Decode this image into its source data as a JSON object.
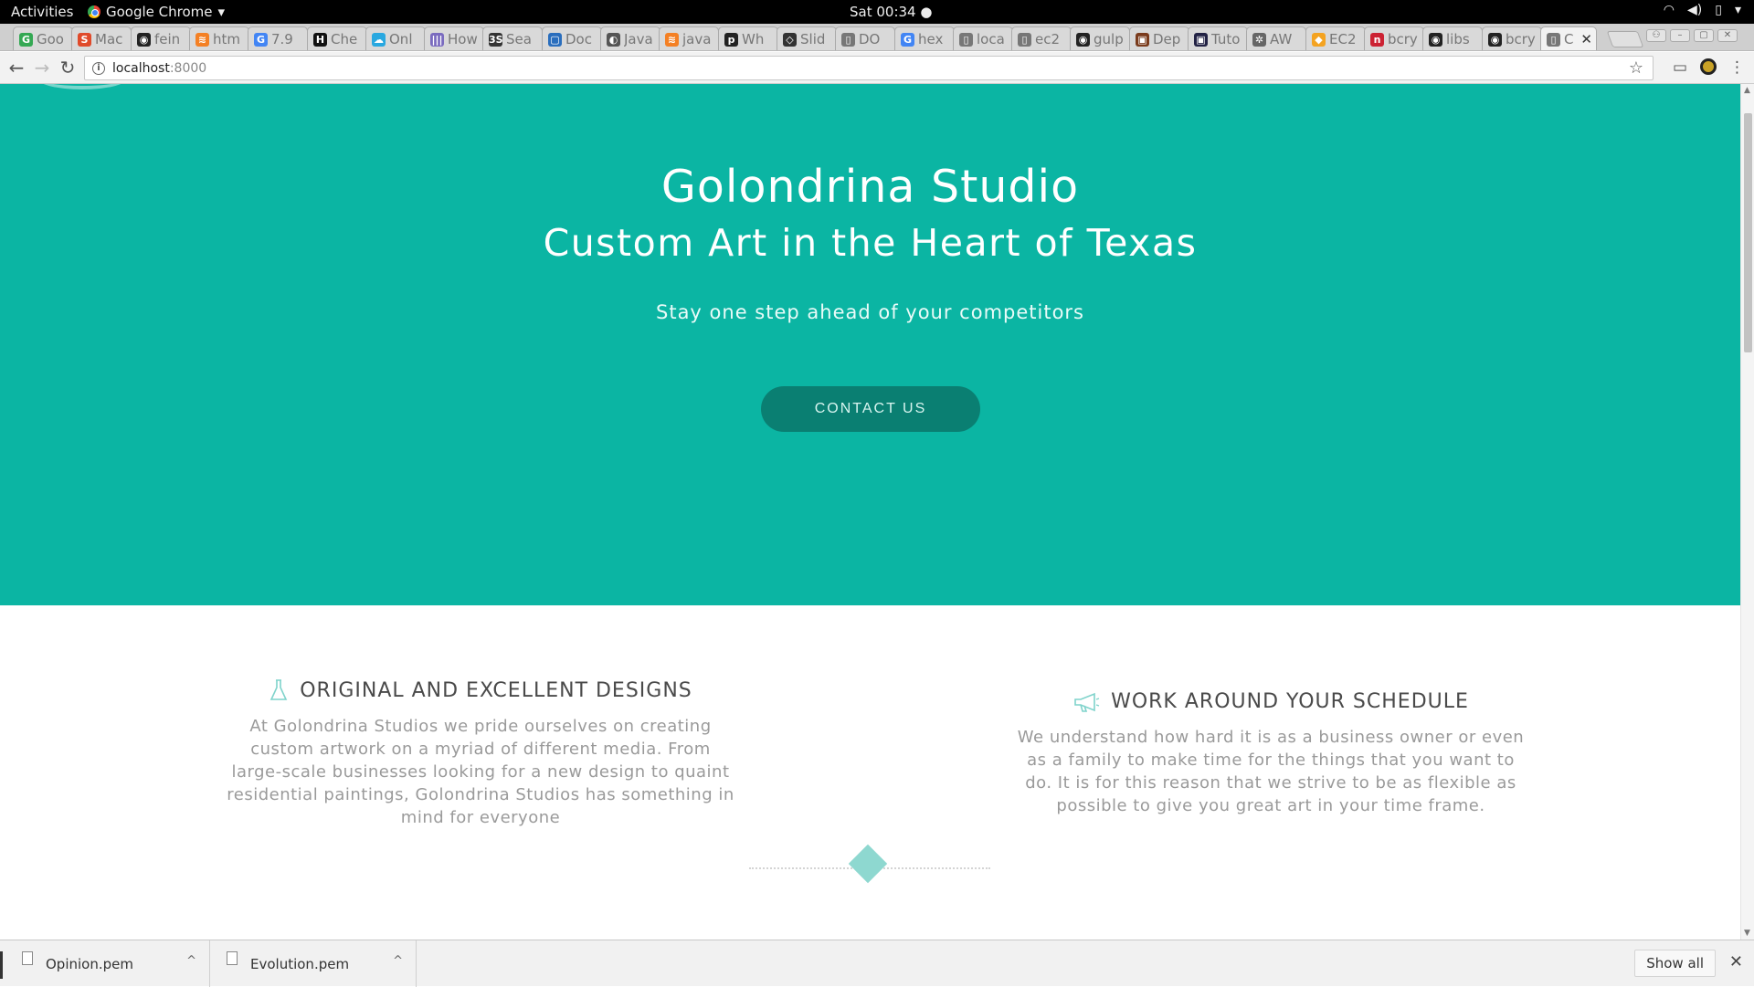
{
  "system_bar": {
    "activities": "Activities",
    "app_name": "Google Chrome",
    "clock": "Sat 00:34",
    "status_icons": [
      "wifi-icon",
      "volume-icon",
      "battery-icon",
      "power-menu-icon"
    ]
  },
  "tabs": [
    {
      "label": "Goo",
      "favicon": "G",
      "color": "#34a853"
    },
    {
      "label": "Mac",
      "favicon": "S",
      "color": "#e04a2a"
    },
    {
      "label": "fein",
      "favicon": "◉",
      "color": "#222222"
    },
    {
      "label": "htm",
      "favicon": "≋",
      "color": "#f48024"
    },
    {
      "label": "7.9",
      "favicon": "G",
      "color": "#4285f4"
    },
    {
      "label": "Che",
      "favicon": "H",
      "color": "#111111"
    },
    {
      "label": "Onl",
      "favicon": "☁",
      "color": "#29a8e0"
    },
    {
      "label": "How",
      "favicon": "|||",
      "color": "#7a6bbf"
    },
    {
      "label": "Sea",
      "favicon": "3S",
      "color": "#333333"
    },
    {
      "label": "Doc",
      "favicon": "▢",
      "color": "#2a6ebd"
    },
    {
      "label": "Java",
      "favicon": "◐",
      "color": "#555555"
    },
    {
      "label": "java",
      "favicon": "≋",
      "color": "#f48024"
    },
    {
      "label": "Wh",
      "favicon": "p",
      "color": "#222222"
    },
    {
      "label": "Slid",
      "favicon": "◇",
      "color": "#333333"
    },
    {
      "label": "DO",
      "favicon": "▯",
      "color": "#777777"
    },
    {
      "label": "hex",
      "favicon": "G",
      "color": "#4285f4"
    },
    {
      "label": "loca",
      "favicon": "▯",
      "color": "#777777"
    },
    {
      "label": "ec2",
      "favicon": "▯",
      "color": "#777777"
    },
    {
      "label": "gulp",
      "favicon": "◉",
      "color": "#222222"
    },
    {
      "label": "Dep",
      "favicon": "▣",
      "color": "#7a3b1c"
    },
    {
      "label": "Tuto",
      "favicon": "▣",
      "color": "#222244"
    },
    {
      "label": "AW",
      "favicon": "✲",
      "color": "#666666"
    },
    {
      "label": "EC2",
      "favicon": "◆",
      "color": "#f4a321"
    },
    {
      "label": "bcry",
      "favicon": "n",
      "color": "#cc2233"
    },
    {
      "label": "libs",
      "favicon": "◉",
      "color": "#222222"
    },
    {
      "label": "bcry",
      "favicon": "◉",
      "color": "#222222"
    },
    {
      "label": "C",
      "favicon": "▯",
      "color": "#777777",
      "active": true
    }
  ],
  "omnibox": {
    "host": "localhost",
    "port": ":8000"
  },
  "hero": {
    "title": "Golondrina Studio",
    "subtitle": "Custom Art in the Heart of Texas",
    "tagline": "Stay one step ahead of your competitors",
    "cta_label": "CONTACT US"
  },
  "features": [
    {
      "icon": "flask-icon",
      "heading": "ORIGINAL AND EXCELLENT DESIGNS",
      "body": "At Golondrina Studios we pride ourselves on creating custom artwork on a myriad of different media. From large-scale businesses looking for a new design to quaint residential paintings, Golondrina Studios has something in mind for everyone"
    },
    {
      "icon": "megaphone-icon",
      "heading": "WORK AROUND YOUR SCHEDULE",
      "body": "We understand how hard it is as a business owner or even as a family to make time for the things that you want to do. It is for this reason that we strive to be as flexible as possible to give you great art in your time frame."
    }
  ],
  "downloads": {
    "items": [
      {
        "filename": "Opinion.pem"
      },
      {
        "filename": "Evolution.pem"
      }
    ],
    "show_all_label": "Show all"
  },
  "colors": {
    "hero_bg": "#0bb5a3",
    "cta_bg": "#0a7f72",
    "accent_icon": "#8ed8d0"
  }
}
